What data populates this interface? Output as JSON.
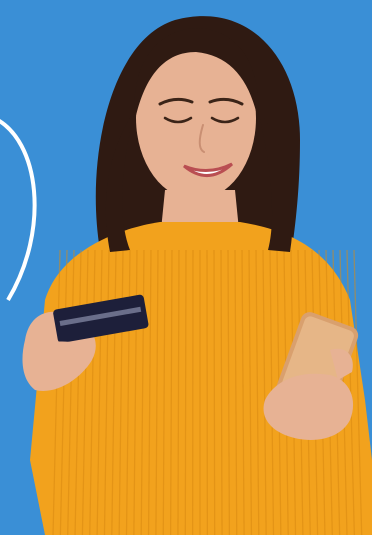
{
  "scene": {
    "background_color": "#3a8fd6",
    "ring_color": "#ffffff",
    "sweater_color": "#f2a21d",
    "hair_color": "#2f1a12",
    "skin_color": "#e7b294",
    "card_color": "#1d1f3a",
    "phone_color": "#d9a06e"
  }
}
